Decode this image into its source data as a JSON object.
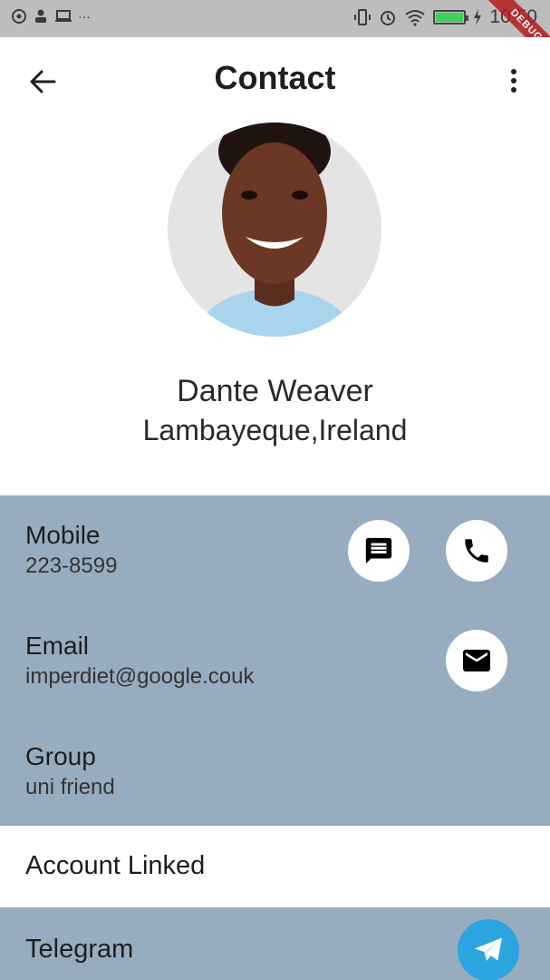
{
  "status_bar": {
    "time": "10:50",
    "debug_label": "DEBUG"
  },
  "app_bar": {
    "title": "Contact"
  },
  "contact": {
    "name": "Dante Weaver",
    "location": "Lambayeque,Ireland"
  },
  "details": [
    {
      "label": "Mobile",
      "value": "223-8599"
    },
    {
      "label": "Email",
      "value": "imperdiet@google.couk"
    },
    {
      "label": "Group",
      "value": "uni friend"
    }
  ],
  "account_linked": {
    "label": "Account Linked"
  },
  "linked_services": [
    {
      "label": "Telegram"
    }
  ],
  "colors": {
    "detail_background": "#98acbf",
    "telegram": "#2aa5e0",
    "battery": "#3bd15a"
  },
  "icons": [
    "back-arrow-icon",
    "more-vert-icon",
    "message-icon",
    "phone-icon",
    "mail-icon",
    "telegram-icon"
  ]
}
